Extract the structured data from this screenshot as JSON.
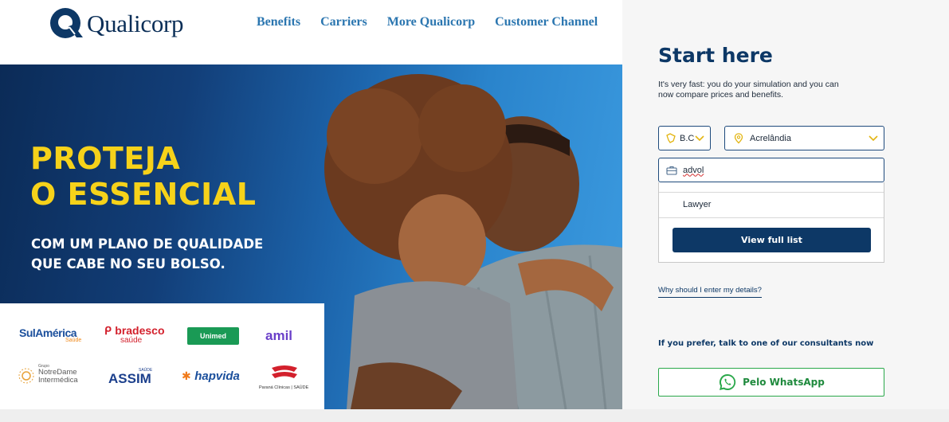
{
  "header": {
    "logo_text": "Qualicorp",
    "nav": [
      "Benefits",
      "Carriers",
      "More Qualicorp",
      "Customer Channel"
    ]
  },
  "hero": {
    "title_lines": [
      "PROTEJA",
      "O ESSENCIAL"
    ],
    "subtitle_lines": [
      "COM UM PLANO DE QUALIDADE",
      "QUE CABE NO SEU BOLSO."
    ],
    "carriers": {
      "sulamerica": "SulAmérica",
      "sulamerica_sub": "Saúde",
      "bradesco": "bradesco",
      "bradesco_sub": "saúde",
      "unimed": "Unimed",
      "amil": "amil",
      "notredame_pre": "Grupo",
      "notredame_1": "NotreDame",
      "notredame_2": "Intermédica",
      "assim": "ASSIM",
      "assim_sub": "SAÚDE",
      "hapvida": "hapvida",
      "parana": "Paraná Clínicas",
      "parana_sub": "SAÚDE"
    }
  },
  "form": {
    "title": "Start here",
    "description": "It's very fast: you do your simulation and you can now compare prices and benefits.",
    "state_value": "B.C",
    "city_value": "Acrelândia",
    "profession_value": "advol",
    "suggestion": "Lawyer",
    "view_full_list": "View full list",
    "why_link": "Why should I enter my details?",
    "prefer_text": "If you prefer, talk to one of our consultants now",
    "whatsapp_label": "Pelo WhatsApp"
  },
  "colors": {
    "navy": "#0d3866",
    "nav_link": "#2b76b0",
    "hero_yellow": "#f6d21a",
    "whatsapp_green": "#2aa84a",
    "select_icon_yellow": "#e3b512"
  }
}
